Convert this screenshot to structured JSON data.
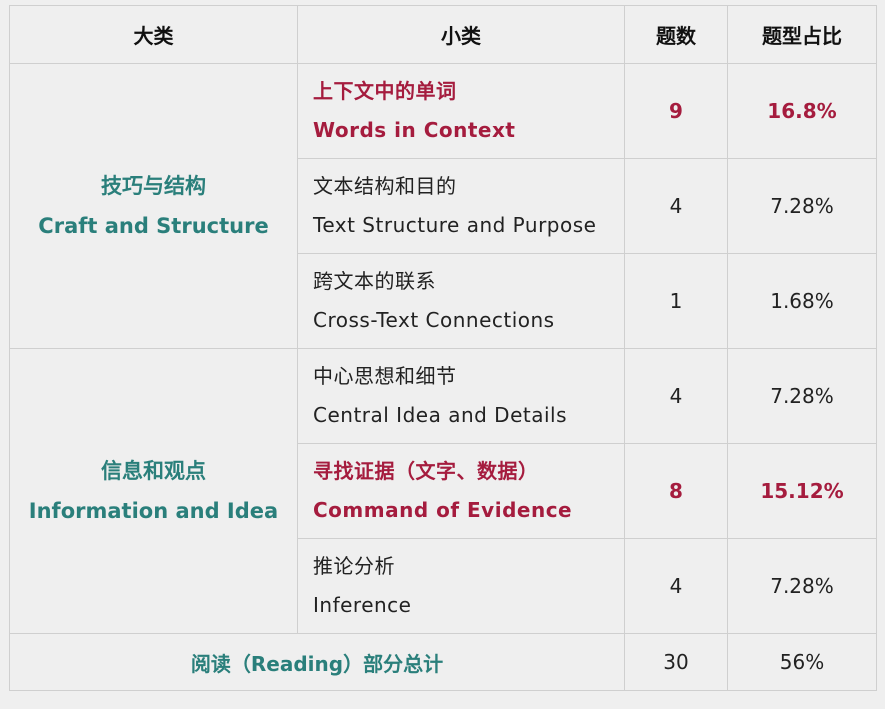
{
  "header": {
    "col1": "大类",
    "col2": "小类",
    "col3": "题数",
    "col4": "题型占比"
  },
  "categories": [
    {
      "zh": "技巧与结构",
      "en": "Craft and Structure"
    },
    {
      "zh": "信息和观点",
      "en": "Information and Idea"
    }
  ],
  "rows": [
    {
      "zh": "上下文中的单词",
      "en": "Words in Context",
      "count": "9",
      "pct": "16.8%",
      "highlight": true
    },
    {
      "zh": "文本结构和目的",
      "en": "Text Structure and Purpose",
      "count": "4",
      "pct": "7.28%",
      "highlight": false
    },
    {
      "zh": "跨文本的联系",
      "en": "Cross-Text Connections",
      "count": "1",
      "pct": "1.68%",
      "highlight": false
    },
    {
      "zh": "中心思想和细节",
      "en": "Central Idea and Details",
      "count": "4",
      "pct": "7.28%",
      "highlight": false
    },
    {
      "zh": "寻找证据（文字、数据）",
      "en": "Command of Evidence",
      "count": "8",
      "pct": "15.12%",
      "highlight": true
    },
    {
      "zh": "推论分析",
      "en": "Inference",
      "count": "4",
      "pct": "7.28%",
      "highlight": false
    }
  ],
  "total": {
    "label": "阅读（Reading）部分总计",
    "count": "30",
    "pct": "56%"
  },
  "colors": {
    "category_text": "#2a7f7b",
    "highlight_text": "#a51c3e",
    "background": "#efefef",
    "border": "#cfcfcf"
  }
}
